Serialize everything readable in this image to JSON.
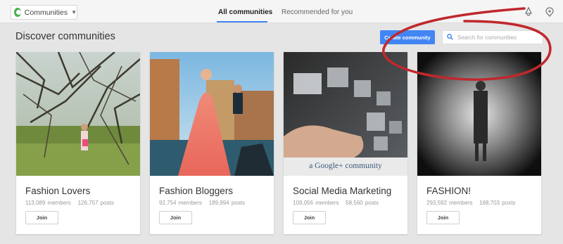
{
  "topbar": {
    "dropdown_label": "Communities",
    "tabs": [
      {
        "label": "All communities",
        "active": true
      },
      {
        "label": "Recommended for you",
        "active": false
      }
    ],
    "icons": [
      "notifications-icon",
      "share-icon"
    ]
  },
  "header": {
    "title": "Discover communities",
    "create_button": "Create community",
    "search_placeholder": "Search for communities"
  },
  "communities": [
    {
      "name": "Fashion Lovers",
      "members": "113,089 members",
      "posts": "126,757 posts",
      "join": "Join"
    },
    {
      "name": "Fashion Bloggers",
      "members": "92,754 members",
      "posts": "189,994 posts",
      "join": "Join"
    },
    {
      "name": "Social Media Marketing",
      "members": "109,056 members",
      "posts": "58,560 posts",
      "join": "Join",
      "badge": "a Google+ community"
    },
    {
      "name": "FASHION!",
      "members": "293,592 members",
      "posts": "168,703 posts",
      "join": "Join"
    }
  ],
  "colors": {
    "accent": "#4285f4",
    "annotation": "#c0282d"
  }
}
